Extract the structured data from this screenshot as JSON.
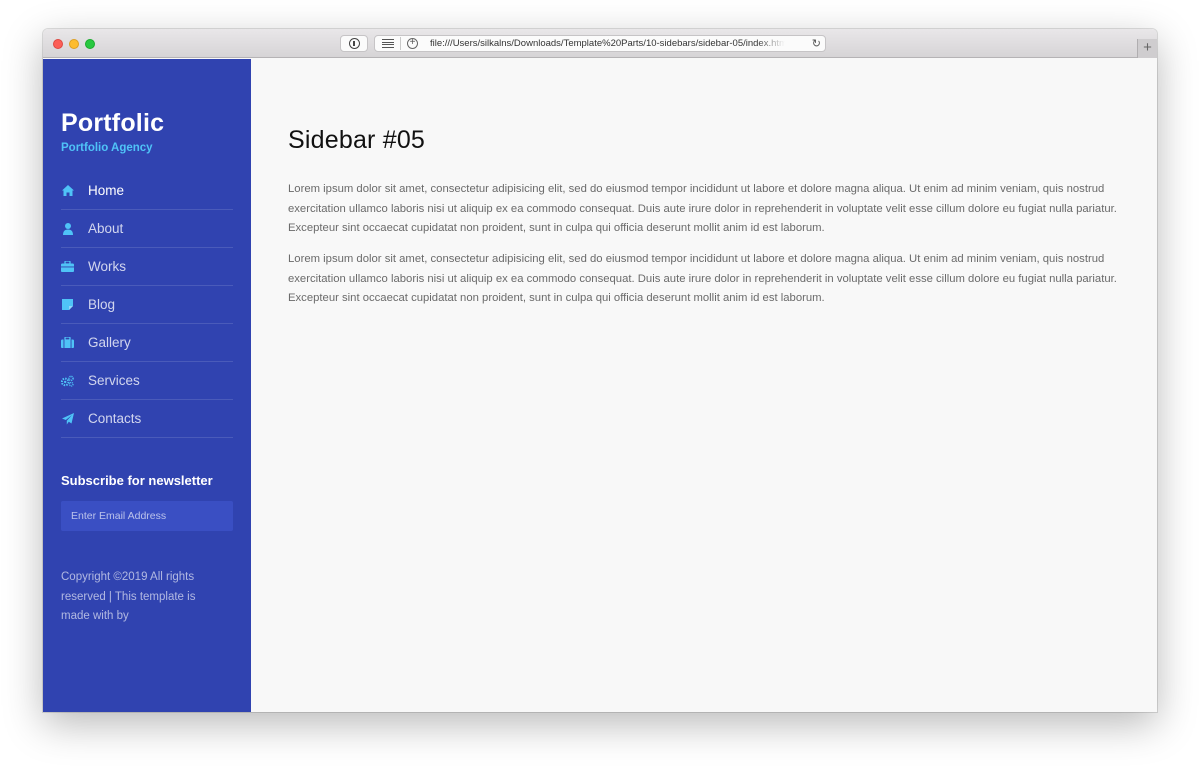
{
  "browser": {
    "url": "file:///Users/silkalns/Downloads/Template%20Parts/10-sidebars/sidebar-05/index.html",
    "new_tab_label": "+",
    "reload_icon": "reload-icon",
    "reader_icon": "reader-icon",
    "privacy_icon": "privacy-icon"
  },
  "sidebar": {
    "brand_title": "Portfolic",
    "brand_subtitle": "Portfolio Agency",
    "toggle_icon": "menu-icon",
    "menu": [
      {
        "label": "Home",
        "icon": "home-icon",
        "active": true
      },
      {
        "label": "About",
        "icon": "user-icon",
        "active": false
      },
      {
        "label": "Works",
        "icon": "briefcase-icon",
        "active": false
      },
      {
        "label": "Blog",
        "icon": "sticky-note-icon",
        "active": false
      },
      {
        "label": "Gallery",
        "icon": "suitcase-icon",
        "active": false
      },
      {
        "label": "Services",
        "icon": "cogs-icon",
        "active": false
      },
      {
        "label": "Contacts",
        "icon": "paper-plane-icon",
        "active": false
      }
    ],
    "newsletter": {
      "heading": "Subscribe for newsletter",
      "email_placeholder": "Enter Email Address",
      "email_value": ""
    },
    "copyright": "Copyright ©2019 All rights reserved | This template is made with by"
  },
  "main": {
    "title": "Sidebar #05",
    "paragraphs": [
      "Lorem ipsum dolor sit amet, consectetur adipisicing elit, sed do eiusmod tempor incididunt ut labore et dolore magna aliqua. Ut enim ad minim veniam, quis nostrud exercitation ullamco laboris nisi ut aliquip ex ea commodo consequat. Duis aute irure dolor in reprehenderit in voluptate velit esse cillum dolore eu fugiat nulla pariatur. Excepteur sint occaecat cupidatat non proident, sunt in culpa qui officia deserunt mollit anim id est laborum.",
      "Lorem ipsum dolor sit amet, consectetur adipisicing elit, sed do eiusmod tempor incididunt ut labore et dolore magna aliqua. Ut enim ad minim veniam, quis nostrud exercitation ullamco laboris nisi ut aliquip ex ea commodo consequat. Duis aute irure dolor in reprehenderit in voluptate velit esse cillum dolore eu fugiat nulla pariatur. Excepteur sint occaecat cupidatat non proident, sunt in culpa qui officia deserunt mollit anim id est laborum."
    ]
  },
  "colors": {
    "sidebar_bg": "#3043b0",
    "accent": "#4fc3f7",
    "main_bg": "#f8f8f8",
    "text_body": "#6a6a6a"
  }
}
